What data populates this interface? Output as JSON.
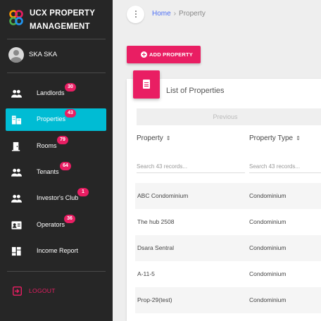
{
  "app": {
    "title_line1": "UCX PROPERTY",
    "title_line2": "MANAGEMENT",
    "user_name": "SKA SKA"
  },
  "colors": {
    "sidebar_bg": "#262626",
    "active_nav": "#00bcd4",
    "accent": "#e91e63",
    "link": "#4c6ef5"
  },
  "sidebar": {
    "items": [
      {
        "label": "Landlords",
        "badge": "30",
        "icon": "people-icon"
      },
      {
        "label": "Properties",
        "badge": "43",
        "icon": "building-icon",
        "active": true
      },
      {
        "label": "Rooms",
        "badge": "79",
        "icon": "door-icon"
      },
      {
        "label": "Tenants",
        "badge": "64",
        "icon": "people-icon"
      },
      {
        "label": "Investor's Club",
        "badge": "1",
        "icon": "people-icon"
      },
      {
        "label": "Operators",
        "badge": "36",
        "icon": "id-card-icon"
      },
      {
        "label": "Income Report",
        "badge": "",
        "icon": "dashboard-icon"
      }
    ],
    "logout_label": "LOGOUT"
  },
  "breadcrumb": {
    "home": "Home",
    "separator": "›",
    "current": "Property"
  },
  "main": {
    "add_button_label": "ADD PROPERTY",
    "card_title": "List of Properties",
    "previous_label": "Previous",
    "columns": [
      "Property",
      "Property Type"
    ],
    "search_placeholders": [
      "Search 43 records...",
      "Search 43 records..."
    ],
    "rows": [
      {
        "property": "ABC Condominium",
        "type": "Condominium"
      },
      {
        "property": "The hub 2508",
        "type": "Condominium"
      },
      {
        "property": "Dsara Sentral",
        "type": "Condominium"
      },
      {
        "property": "A-11-5",
        "type": "Condominium"
      },
      {
        "property": "Prop-29(test)",
        "type": "Condominium"
      }
    ]
  }
}
